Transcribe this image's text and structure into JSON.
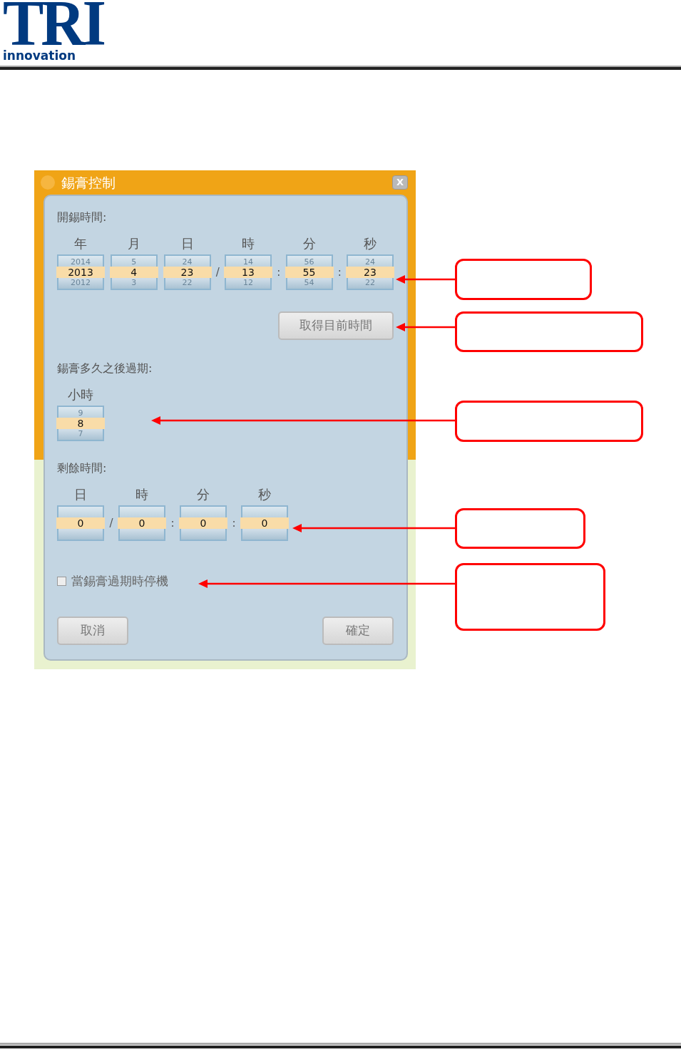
{
  "header": {
    "logo_mark": "TRI",
    "logo_text": "innovation"
  },
  "dialog": {
    "title": "錫膏控制",
    "close_label": "X",
    "sections": [
      {
        "label": "開錫時間:",
        "spinners": [
          {
            "unit": "年",
            "prev": "2014",
            "value": "2013",
            "next": "2012"
          },
          {
            "unit": "月",
            "prev": "5",
            "value": "4",
            "next": "3"
          },
          {
            "unit": "日",
            "prev": "24",
            "value": "23",
            "next": "22",
            "separator_after": "/"
          },
          {
            "unit": "時",
            "prev": "14",
            "value": "13",
            "next": "12",
            "separator_after": ":"
          },
          {
            "unit": "分",
            "prev": "56",
            "value": "55",
            "next": "54",
            "separator_after": ":"
          },
          {
            "unit": "秒",
            "prev": "24",
            "value": "23",
            "next": "22"
          }
        ],
        "button": "取得目前時間"
      },
      {
        "label": "錫膏多久之後過期:",
        "spinners": [
          {
            "unit": "小時",
            "prev": "9",
            "value": "8",
            "next": "7"
          }
        ]
      },
      {
        "label": "剩餘時間:",
        "spinners": [
          {
            "unit": "日",
            "value": "0",
            "separator_after": "/"
          },
          {
            "unit": "時",
            "value": "0",
            "separator_after": ":"
          },
          {
            "unit": "分",
            "value": "0",
            "separator_after": ":"
          },
          {
            "unit": "秒",
            "value": "0"
          }
        ]
      }
    ],
    "checkbox": {
      "label": "當錫膏過期時停機",
      "checked": false
    },
    "buttons": [
      {
        "label": "取消"
      },
      {
        "label": "確定"
      }
    ]
  }
}
